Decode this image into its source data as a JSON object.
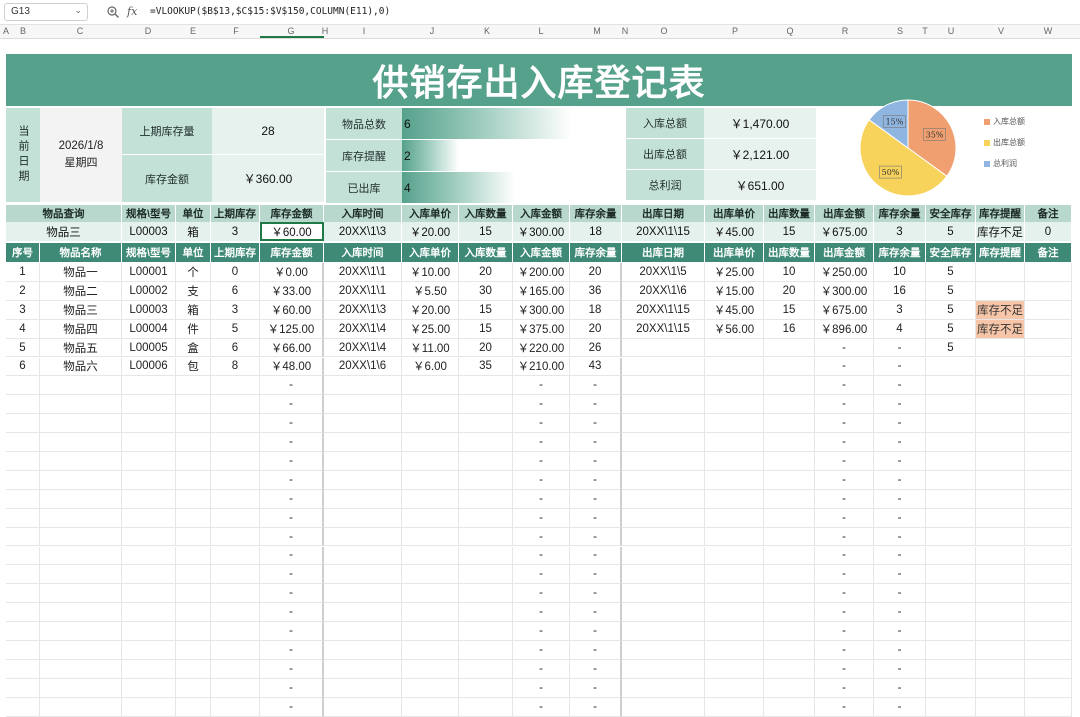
{
  "formula_bar": {
    "cell_ref": "G13",
    "fx_label": "fx",
    "formula": "=VLOOKUP($B$13,$C$15:$V$150,COLUMN(E11),0)"
  },
  "columns": [
    "A",
    "B",
    "C",
    "D",
    "E",
    "F",
    "G",
    "H",
    "I",
    "J",
    "K",
    "L",
    "M",
    "N",
    "O",
    "P",
    "Q",
    "R",
    "S",
    "T",
    "U",
    "V",
    "W"
  ],
  "title": "供销存出入库登记表",
  "summary": {
    "current_date_label": "当前日期",
    "date": "2026/1/8",
    "weekday": "星期四",
    "prev_stock_label": "上期库存量",
    "prev_stock_value": "28",
    "stock_amount_label": "库存金额",
    "stock_amount_value": "￥360.00",
    "total_items_label": "物品总数",
    "total_items_value": "6",
    "stock_alert_label": "库存提醒",
    "stock_alert_value": "2",
    "shipped_label": "已出库",
    "shipped_value": "4",
    "in_total_label": "入库总额",
    "in_total_value": "￥1,470.00",
    "out_total_label": "出库总额",
    "out_total_value": "￥2,121.00",
    "profit_label": "总利润",
    "profit_value": "￥651.00"
  },
  "bars": {
    "total_items": 6,
    "stock_alert": 2,
    "shipped": 4,
    "max": 6
  },
  "chart_data": {
    "type": "pie",
    "slices": [
      {
        "label": "入库总额",
        "value": 35,
        "display": "35%",
        "color": "#f0a070"
      },
      {
        "label": "出库总额",
        "value": 50,
        "display": "50%",
        "color": "#f7d35c"
      },
      {
        "label": "总利润",
        "value": 15,
        "display": "15%",
        "color": "#8fb6e0"
      }
    ],
    "legend_position": "right"
  },
  "query_headers": [
    "物品查询",
    "规格\\型号",
    "单位",
    "上期库存",
    "库存金额",
    "入库时间",
    "入库单价",
    "入库数量",
    "入库金额",
    "库存余量",
    "出库日期",
    "出库单价",
    "出库数量",
    "出库金额",
    "库存余量",
    "安全库存",
    "库存提醒",
    "备注"
  ],
  "query_row": [
    "物品三",
    "L00003",
    "箱",
    "3",
    "￥60.00",
    "20XX\\1\\3",
    "￥20.00",
    "15",
    "￥300.00",
    "18",
    "20XX\\1\\15",
    "￥45.00",
    "15",
    "￥675.00",
    "3",
    "5",
    "库存不足",
    "0"
  ],
  "table_headers": [
    "序号",
    "物品名称",
    "规格\\型号",
    "单位",
    "上期库存",
    "库存金额",
    "入库时间",
    "入库单价",
    "入库数量",
    "入库金额",
    "库存余量",
    "出库日期",
    "出库单价",
    "出库数量",
    "出库金额",
    "库存余量",
    "安全库存",
    "库存提醒",
    "备注"
  ],
  "rows": [
    [
      "1",
      "物品一",
      "L00001",
      "个",
      "0",
      "￥0.00",
      "20XX\\1\\1",
      "￥10.00",
      "20",
      "￥200.00",
      "20",
      "20XX\\1\\5",
      "￥25.00",
      "10",
      "￥250.00",
      "10",
      "5",
      "",
      ""
    ],
    [
      "2",
      "物品二",
      "L00002",
      "支",
      "6",
      "￥33.00",
      "20XX\\1\\1",
      "￥5.50",
      "30",
      "￥165.00",
      "36",
      "20XX\\1\\6",
      "￥15.00",
      "20",
      "￥300.00",
      "16",
      "5",
      "",
      ""
    ],
    [
      "3",
      "物品三",
      "L00003",
      "箱",
      "3",
      "￥60.00",
      "20XX\\1\\3",
      "￥20.00",
      "15",
      "￥300.00",
      "18",
      "20XX\\1\\15",
      "￥45.00",
      "15",
      "￥675.00",
      "3",
      "5",
      "库存不足",
      ""
    ],
    [
      "4",
      "物品四",
      "L00004",
      "件",
      "5",
      "￥125.00",
      "20XX\\1\\4",
      "￥25.00",
      "15",
      "￥375.00",
      "20",
      "20XX\\1\\15",
      "￥56.00",
      "16",
      "￥896.00",
      "4",
      "5",
      "库存不足",
      ""
    ],
    [
      "5",
      "物品五",
      "L00005",
      "盒",
      "6",
      "￥66.00",
      "20XX\\1\\4",
      "￥11.00",
      "20",
      "￥220.00",
      "26",
      "",
      "",
      "",
      "-",
      "-",
      "5",
      "",
      ""
    ],
    [
      "6",
      "物品六",
      "L00006",
      "包",
      "8",
      "￥48.00",
      "20XX\\1\\6",
      "￥6.00",
      "35",
      "￥210.00",
      "43",
      "",
      "",
      "",
      "-",
      "-",
      "",
      "",
      ""
    ]
  ],
  "empty_marker": "-",
  "empty_rows": 18
}
